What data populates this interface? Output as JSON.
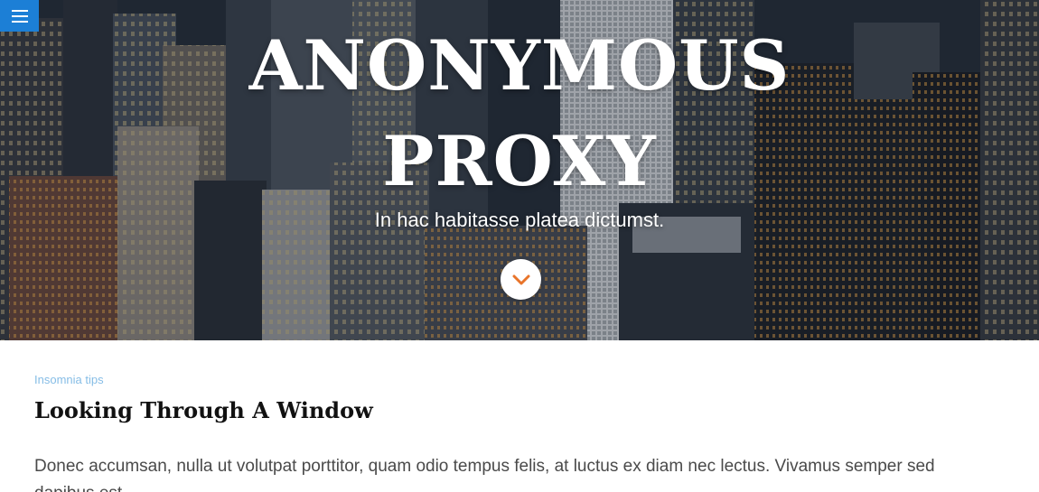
{
  "hero": {
    "title_line1": "ANONYMOUS",
    "title_line2": "PROXY",
    "subtitle": "In hac habitasse platea dictumst.",
    "menu_icon": "hamburger-menu-icon",
    "scroll_icon": "chevron-down-icon"
  },
  "article": {
    "category": "Insomnia tips",
    "title": "Looking Through A Window",
    "excerpt": "Donec accumsan, nulla ut volutpat porttitor, quam odio tempus felis, at luctus ex diam nec lectus. Vivamus semper sed dapibus est."
  },
  "colors": {
    "menu_button": "#1c7fd6",
    "chevron_accent": "#e8742a",
    "category_text": "#86bde6",
    "title_text": "#111111",
    "body_text": "#4a4a4a"
  }
}
